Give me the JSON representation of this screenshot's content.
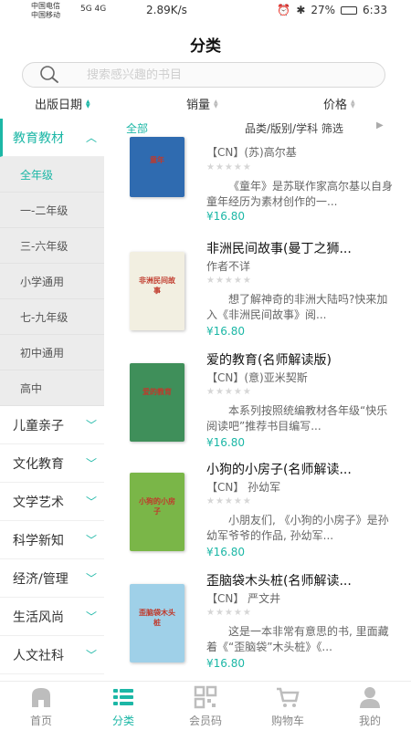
{
  "status": {
    "carrier1": "中国电信",
    "carrier2": "中国移动",
    "signal_label": "5G 4G",
    "speed": "2.89K/s",
    "battery": "27%",
    "time": "6:33"
  },
  "page_title": "分类",
  "search": {
    "placeholder": "搜索感兴趣的书目"
  },
  "sort": [
    {
      "label": "出版日期",
      "state": "active"
    },
    {
      "label": "销量",
      "state": "none"
    },
    {
      "label": "价格",
      "state": "none"
    }
  ],
  "sidebar": {
    "active_category": "教育教材",
    "subs": [
      "全年级",
      "一-二年级",
      "三-六年级",
      "小学通用",
      "七-九年级",
      "初中通用",
      "高中"
    ],
    "active_sub": 0,
    "categories": [
      "儿童亲子",
      "文化教育",
      "文学艺术",
      "科学新知",
      "经济/管理",
      "生活风尚",
      "人文社科"
    ]
  },
  "filter": {
    "all_label": "全部",
    "filter_label": "品类/版别/学科 筛选"
  },
  "books": [
    {
      "title": "",
      "author": "【CN】(苏)高尔基",
      "desc": "《童年》是苏联作家高尔基以自身童年经历为素材创作的一...",
      "price": "¥16.80",
      "cover_text": "童年",
      "cover_color": "#2f6bb0"
    },
    {
      "title": "非洲民间故事(曼丁之狮...",
      "author": "作者不详",
      "desc": "想了解神奇的非洲大陆吗?快来加入《非洲民间故事》阅...",
      "price": "¥16.80",
      "cover_text": "非洲民间故事",
      "cover_color": "#f2efe1"
    },
    {
      "title": "爱的教育(名师解读版)",
      "author": "【CN】(意)亚米契斯",
      "desc": "本系列按照统编教材各年级“快乐阅读吧”推荐书目编写...",
      "price": "¥16.80",
      "cover_text": "爱的教育",
      "cover_color": "#3f8f5a"
    },
    {
      "title": "小狗的小房子(名师解读...",
      "author": "【CN】 孙幼军",
      "desc": "小朋友们, 《小狗的小房子》是孙幼军爷爷的作品, 孙幼军...",
      "price": "¥16.80",
      "cover_text": "小狗的小房子",
      "cover_color": "#7ab648"
    },
    {
      "title": "歪脑袋木头桩(名师解读...",
      "author": "【CN】 严文井",
      "desc": "这是一本非常有意思的书, 里面藏着《“歪脑袋”木头桩》《...",
      "price": "¥16.80",
      "cover_text": "歪脑袋木头桩",
      "cover_color": "#9fd0e8"
    }
  ],
  "nav": [
    {
      "label": "首页",
      "icon": "home-icon"
    },
    {
      "label": "分类",
      "icon": "list-icon"
    },
    {
      "label": "会员码",
      "icon": "qr-code-icon"
    },
    {
      "label": "购物车",
      "icon": "cart-icon"
    },
    {
      "label": "我的",
      "icon": "profile-icon"
    }
  ],
  "colors": {
    "accent": "#1cb7a6",
    "price": "#1cb7a6",
    "sidebar_sub_bg": "#ececec"
  },
  "rating_stars": "★★★★★"
}
